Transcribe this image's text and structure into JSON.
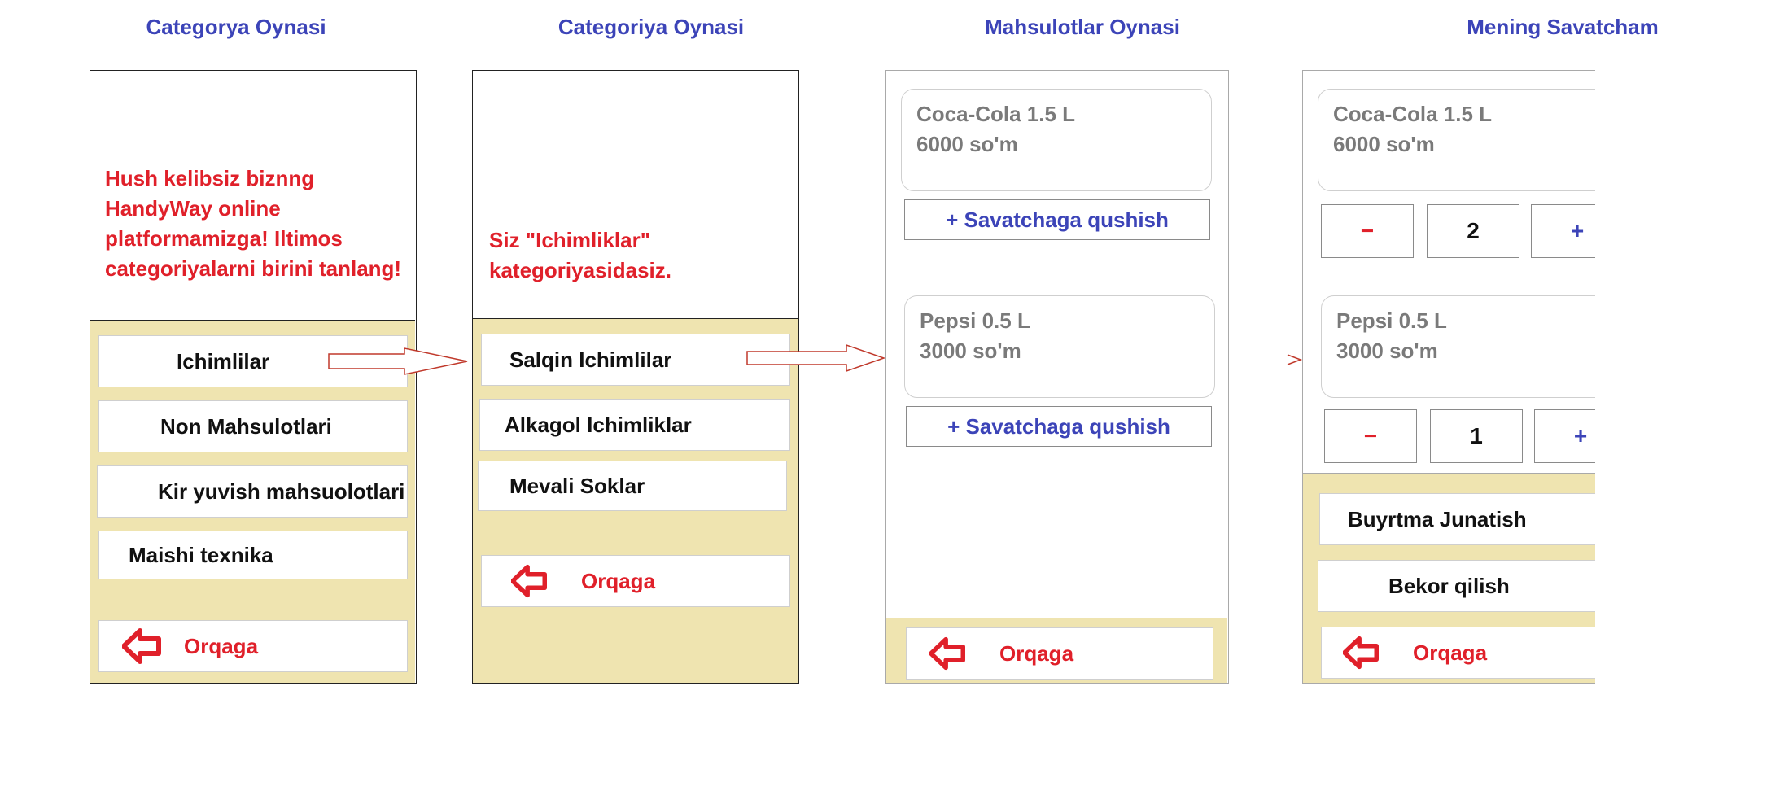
{
  "screens": [
    {
      "title": "Categorya Oynasi",
      "message": "Hush kelibsiz biznng HandyWay online platformamizga! Iltimos categoriyalarni birini tanlang!",
      "items": [
        "Ichimlilar",
        "Non Mahsulotlari",
        "Kir yuvish mahsuolotlari",
        "Maishi texnika"
      ],
      "back": "Orqaga"
    },
    {
      "title": "Categoriya Oynasi",
      "message": "Siz \"Ichimliklar\" kategoriyasidasiz.",
      "items": [
        "Salqin Ichimlilar",
        "Alkagol Ichimliklar",
        "Mevali Soklar"
      ],
      "back": "Orqaga"
    },
    {
      "title": "Mahsulotlar Oynasi",
      "products": [
        {
          "name": "Coca-Cola 1.5 L",
          "price": "6000 so'm"
        },
        {
          "name": "Pepsi 0.5 L",
          "price": "3000 so'm"
        }
      ],
      "add_label": "+ Savatchaga qushish",
      "back": "Orqaga"
    },
    {
      "title": "Mening Savatcham",
      "products": [
        {
          "name": "Coca-Cola 1.5 L",
          "price": "6000 so'm",
          "qty": "2"
        },
        {
          "name": "Pepsi 0.5 L",
          "price": "3000 so'm",
          "qty": "1"
        }
      ],
      "minus": "−",
      "plus": "+",
      "order": "Buyrtma Junatish",
      "cancel": "Bekor qilish",
      "back": "Orqaga"
    }
  ],
  "colors": {
    "title": "#3c44b8",
    "message": "#e0202a",
    "panel": "#efe4b0",
    "arrow": "#c0392b"
  }
}
